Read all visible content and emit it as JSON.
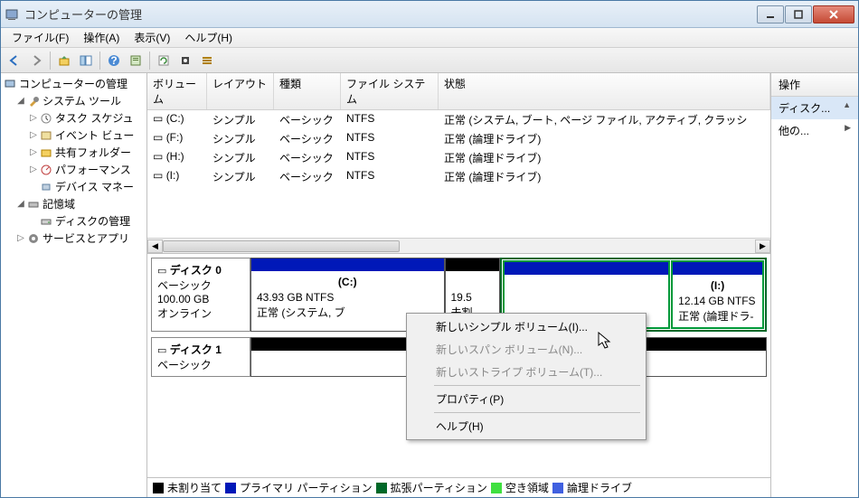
{
  "window": {
    "title": "コンピューターの管理"
  },
  "menu": {
    "file": "ファイル(F)",
    "action": "操作(A)",
    "view": "表示(V)",
    "help": "ヘルプ(H)"
  },
  "tree": {
    "root": "コンピューターの管理",
    "system_tools": "システム ツール",
    "task_sched": "タスク スケジュ",
    "event_viewer": "イベント ビュー",
    "shared_folders": "共有フォルダー",
    "performance": "パフォーマンス",
    "device_mgr": "デバイス マネー",
    "storage": "記憶域",
    "disk_mgmt": "ディスクの管理",
    "services_apps": "サービスとアプリ"
  },
  "columns": {
    "volume": "ボリューム",
    "layout": "レイアウト",
    "type": "種類",
    "fs": "ファイル システム",
    "status": "状態"
  },
  "volumes": [
    {
      "vol": "(C:)",
      "layout": "シンプル",
      "type": "ベーシック",
      "fs": "NTFS",
      "status": "正常 (システム, ブート, ページ ファイル, アクティブ, クラッシ"
    },
    {
      "vol": "(F:)",
      "layout": "シンプル",
      "type": "ベーシック",
      "fs": "NTFS",
      "status": "正常 (論理ドライブ)"
    },
    {
      "vol": "(H:)",
      "layout": "シンプル",
      "type": "ベーシック",
      "fs": "NTFS",
      "status": "正常 (論理ドライブ)"
    },
    {
      "vol": "(I:)",
      "layout": "シンプル",
      "type": "ベーシック",
      "fs": "NTFS",
      "status": "正常 (論理ドライブ)"
    }
  ],
  "disk0": {
    "name": "ディスク 0",
    "kind": "ベーシック",
    "size": "100.00 GB",
    "state": "オンライン",
    "part_c": {
      "letter": "(C:)",
      "size": "43.93 GB NTFS",
      "stat": "正常 (システム, ブ"
    },
    "part_unalloc": {
      "size": "19.5",
      "stat": "未割"
    },
    "part_i": {
      "letter": "(I:)",
      "size": "12.14 GB NTFS",
      "stat": "正常 (論理ドラ-"
    }
  },
  "disk1": {
    "name": "ディスク 1",
    "kind": "ベーシック"
  },
  "legend": {
    "unalloc": "未割り当て",
    "primary": "プライマリ パーティション",
    "extended": "拡張パーティション",
    "free": "空き領域",
    "logical": "論理ドライブ"
  },
  "actions": {
    "title": "操作",
    "disk": "ディスク...",
    "other": "他の..."
  },
  "ctx": {
    "simple": "新しいシンプル ボリューム(I)...",
    "span": "新しいスパン ボリューム(N)...",
    "stripe": "新しいストライプ ボリューム(T)...",
    "prop": "プロパティ(P)",
    "help": "ヘルプ(H)"
  }
}
